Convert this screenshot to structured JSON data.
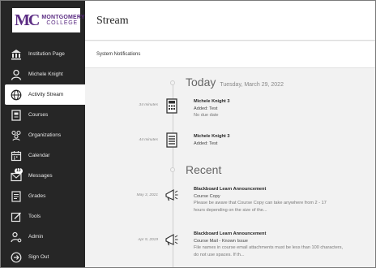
{
  "logo": {
    "mark": "MC",
    "line1": "MONTGOMERY",
    "line2": "COLLEGE"
  },
  "sidebar": {
    "items": [
      {
        "label": "Institution Page",
        "icon": "institution-icon"
      },
      {
        "label": "Michele Knight",
        "icon": "user-icon"
      },
      {
        "label": "Activity Stream",
        "icon": "globe-icon",
        "active": true
      },
      {
        "label": "Courses",
        "icon": "courses-icon"
      },
      {
        "label": "Organizations",
        "icon": "organizations-icon"
      },
      {
        "label": "Calendar",
        "icon": "calendar-icon"
      },
      {
        "label": "Messages",
        "icon": "messages-icon",
        "badge": "13"
      },
      {
        "label": "Grades",
        "icon": "grades-icon"
      },
      {
        "label": "Tools",
        "icon": "tools-icon"
      },
      {
        "label": "Admin",
        "icon": "admin-icon"
      },
      {
        "label": "Sign Out",
        "icon": "sign-out-icon"
      }
    ]
  },
  "header": {
    "title": "Stream"
  },
  "subbar": {
    "label": "System Notifications"
  },
  "today": {
    "title": "Today",
    "date": "Tuesday, March 29, 2022",
    "items": [
      {
        "time": "34 minutes",
        "icon": "calculator-icon",
        "title": "Michele Knight 3",
        "line1": "Added: Test",
        "line2": "No due date"
      },
      {
        "time": "44 minutes",
        "icon": "document-icon",
        "title": "Michele Knight 3",
        "line1": "Added: Test"
      }
    ]
  },
  "recent": {
    "title": "Recent",
    "items": [
      {
        "time": "May 3, 2021",
        "icon": "megaphone-icon",
        "title": "Blackboard Learn Announcement",
        "line1": "Course Copy",
        "desc1": "Please be aware that Course Copy can take anywhere from 2 - 17",
        "desc2": "hours depending on the size of the..."
      },
      {
        "time": "Apr 9, 2019",
        "icon": "megaphone-icon",
        "title": "Blackboard Learn Announcement",
        "line1": "Course Mail - Known Issue",
        "desc1": "File names in course email attachments must be less than 100 characters,",
        "desc2": "do not use spaces. If th..."
      }
    ]
  }
}
